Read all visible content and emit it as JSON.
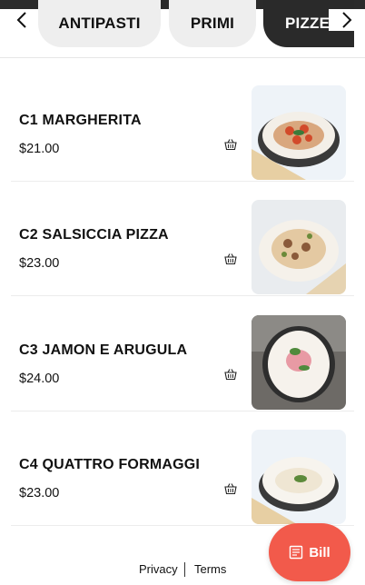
{
  "categories": {
    "items": [
      {
        "label": "ANTIPASTI",
        "active": false
      },
      {
        "label": "PRIMI",
        "active": false
      },
      {
        "label": "PIZZE",
        "active": true
      }
    ],
    "prev_icon": "chevron-left-icon",
    "next_icon": "chevron-right-icon"
  },
  "menu": {
    "items": [
      {
        "name": "C1 MARGHERITA",
        "price": "$21.00",
        "icon": "basket-icon"
      },
      {
        "name": "C2 SALSICCIA PIZZA",
        "price": "$23.00",
        "icon": "basket-icon"
      },
      {
        "name": "C3 JAMON E ARUGULA",
        "price": "$24.00",
        "icon": "basket-icon"
      },
      {
        "name": "C4 QUATTRO FORMAGGI",
        "price": "$23.00",
        "icon": "basket-icon"
      }
    ]
  },
  "footer": {
    "privacy": "Privacy",
    "terms": "Terms"
  },
  "bill_button": {
    "label": "Bill",
    "icon": "receipt-icon",
    "color": "#f25a4b"
  },
  "colors": {
    "active_tab": "#2a2a2a",
    "inactive_tab": "#eeeeee"
  }
}
